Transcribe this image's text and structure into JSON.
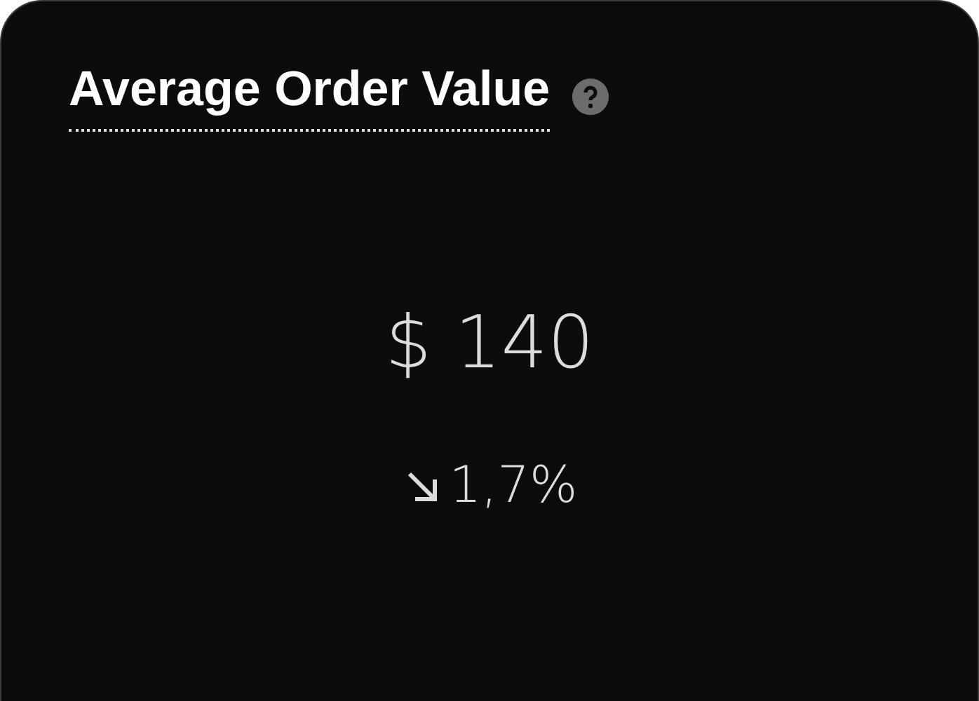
{
  "card": {
    "title": "Average Order Value",
    "value": "$ 140",
    "change": {
      "kind": "down",
      "text": "1,7%"
    }
  }
}
